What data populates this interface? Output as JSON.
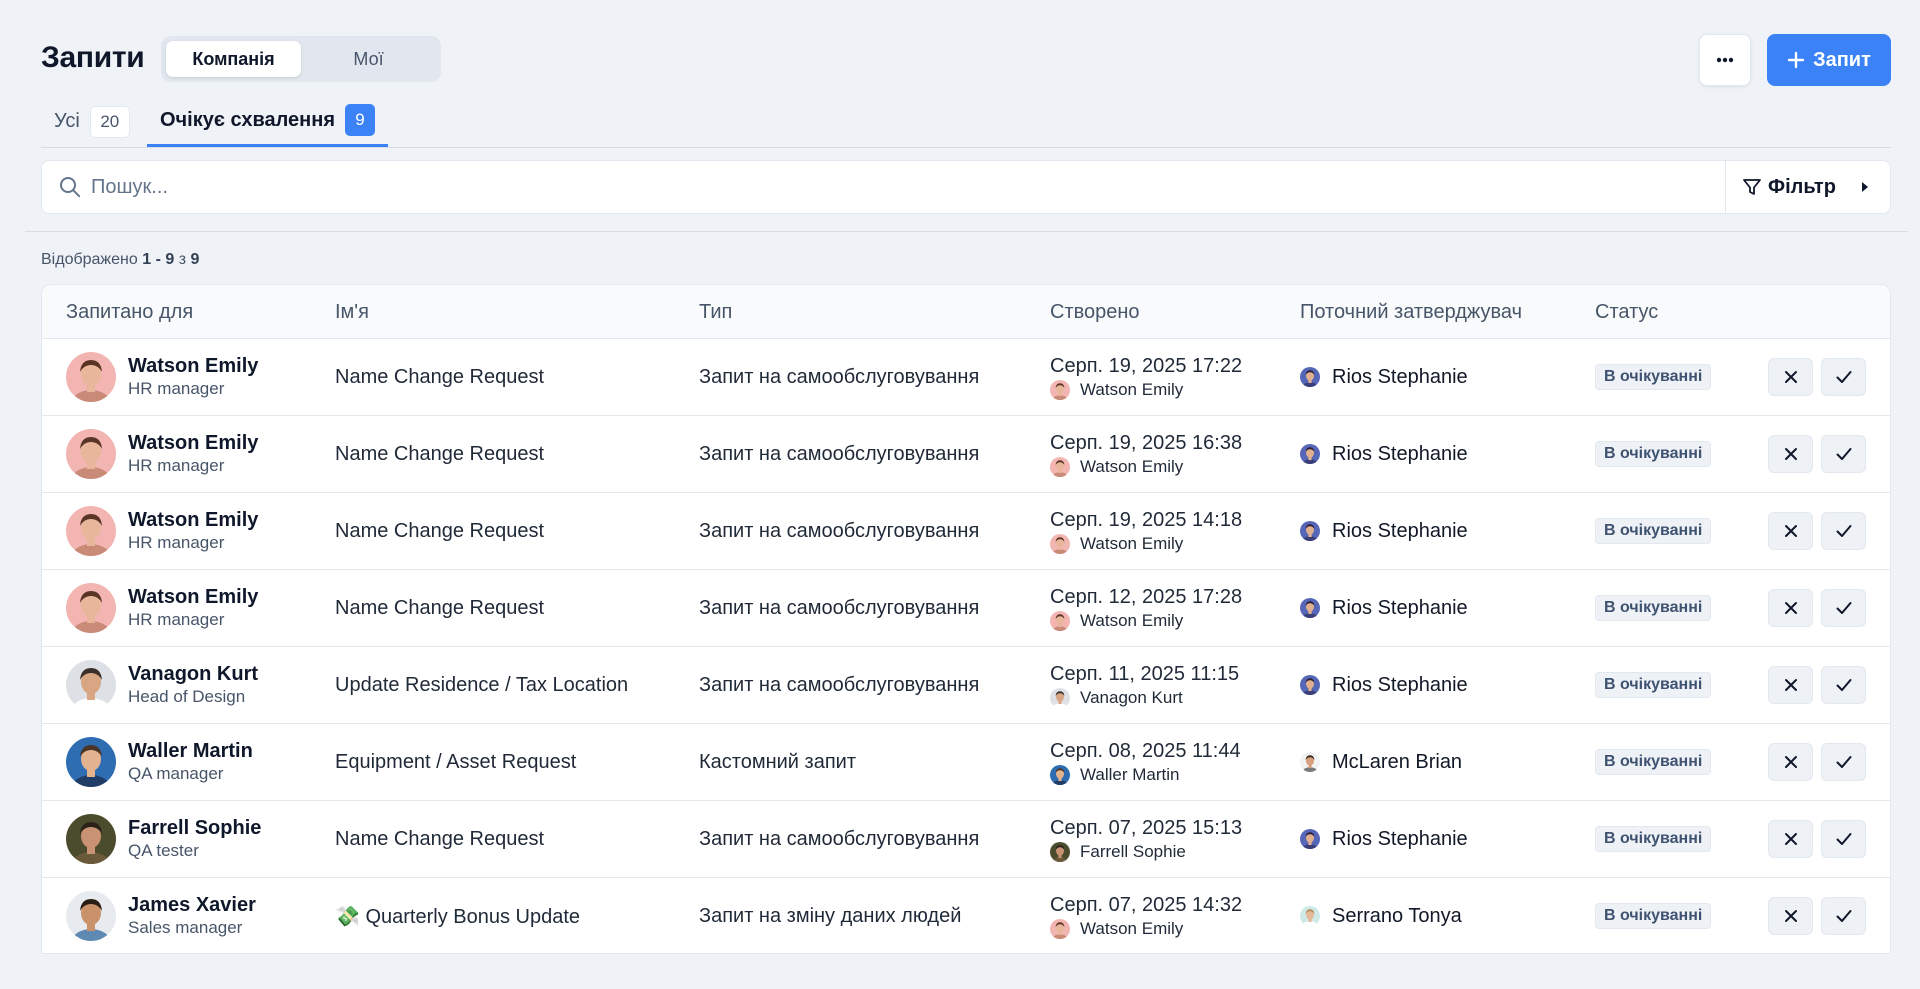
{
  "header": {
    "title": "Запити",
    "scope_tabs": [
      {
        "label": "Компанія",
        "active": true
      },
      {
        "label": "Мої",
        "active": false
      }
    ],
    "more_label": "•••",
    "add_label": "Запит"
  },
  "tabs": [
    {
      "label": "Усі",
      "count": "20",
      "active": false
    },
    {
      "label": "Очікує схвалення",
      "count": "9",
      "active": true
    }
  ],
  "search": {
    "placeholder": "Пошук...",
    "value": ""
  },
  "filter_label": "Фільтр",
  "results": {
    "prefix": "Відображено",
    "range": "1 - 9",
    "of": "з",
    "total": "9"
  },
  "columns": [
    "Запитано для",
    "Ім'я",
    "Тип",
    "Створено",
    "Поточний затверджувач",
    "Статус"
  ],
  "rows": [
    {
      "name": "Watson Emily",
      "role": "HR manager",
      "request": "Name Change Request",
      "type": "Запит на самообслуговування",
      "date": "Серп. 19, 2025 17:22",
      "created_by": "Watson Emily",
      "approver": "Rios Stephanie",
      "status": "В очікуванні"
    },
    {
      "name": "Watson Emily",
      "role": "HR manager",
      "request": "Name Change Request",
      "type": "Запит на самообслуговування",
      "date": "Серп. 19, 2025 16:38",
      "created_by": "Watson Emily",
      "approver": "Rios Stephanie",
      "status": "В очікуванні"
    },
    {
      "name": "Watson Emily",
      "role": "HR manager",
      "request": "Name Change Request",
      "type": "Запит на самообслуговування",
      "date": "Серп. 19, 2025 14:18",
      "created_by": "Watson Emily",
      "approver": "Rios Stephanie",
      "status": "В очікуванні"
    },
    {
      "name": "Watson Emily",
      "role": "HR manager",
      "request": "Name Change Request",
      "type": "Запит на самообслуговування",
      "date": "Серп. 12, 2025 17:28",
      "created_by": "Watson Emily",
      "approver": "Rios Stephanie",
      "status": "В очікуванні"
    },
    {
      "name": "Vanagon Kurt",
      "role": "Head of Design",
      "request": "Update Residence / Tax Location",
      "type": "Запит на самообслуговування",
      "date": "Серп. 11, 2025 11:15",
      "created_by": "Vanagon Kurt",
      "approver": "Rios Stephanie",
      "status": "В очікуванні"
    },
    {
      "name": "Waller Martin",
      "role": "QA manager",
      "request": "Equipment / Asset Request",
      "type": "Кастомний запит",
      "date": "Серп. 08, 2025 11:44",
      "created_by": "Waller Martin",
      "approver": "McLaren Brian",
      "status": "В очікуванні"
    },
    {
      "name": "Farrell Sophie",
      "role": "QA tester",
      "request": "Name Change Request",
      "type": "Запит на самообслуговування",
      "date": "Серп. 07, 2025 15:13",
      "created_by": "Farrell Sophie",
      "approver": "Rios Stephanie",
      "status": "В очікуванні"
    },
    {
      "name": "James Xavier",
      "role": "Sales manager",
      "request": "💸 Quarterly Bonus Update",
      "type": "Запит на зміну даних людей",
      "date": "Серп. 07, 2025 14:32",
      "created_by": "Watson Emily",
      "approver": "Serrano Tonya",
      "status": "В очікуванні"
    }
  ],
  "avatar_colors": {
    "Watson Emily": {
      "bg": "#f3b5b2",
      "skin": "#e8b79b",
      "hair": "#5a3424",
      "shirt": "#c98a78"
    },
    "Vanagon Kurt": {
      "bg": "#dde1e5",
      "skin": "#d9a684",
      "hair": "#3b2f2a",
      "shirt": "#ffffff"
    },
    "Waller Martin": {
      "bg": "#2f6db3",
      "skin": "#e3b28f",
      "hair": "#4a3528",
      "shirt": "#1f3d66"
    },
    "Farrell Sophie": {
      "bg": "#4b4b2e",
      "skin": "#c99274",
      "hair": "#2c2118",
      "shirt": "#6a5a3a"
    },
    "James Xavier": {
      "bg": "#e7eaee",
      "skin": "#c9926a",
      "hair": "#2a1d15",
      "shirt": "#5e89b3"
    },
    "Rios Stephanie": {
      "bg": "#5767b8",
      "skin": "#e1b08f",
      "hair": "#2c2139",
      "shirt": "#3a3f7a"
    },
    "McLaren Brian": {
      "bg": "#f2f2f2",
      "skin": "#d7a07c",
      "hair": "#3a2a20",
      "shirt": "#7a7a7a"
    },
    "Serrano Tonya": {
      "bg": "#cfeae6",
      "skin": "#e6b99b",
      "hair": "#b38a58",
      "shirt": "#ffffff"
    }
  },
  "accent": "#3b82f6"
}
